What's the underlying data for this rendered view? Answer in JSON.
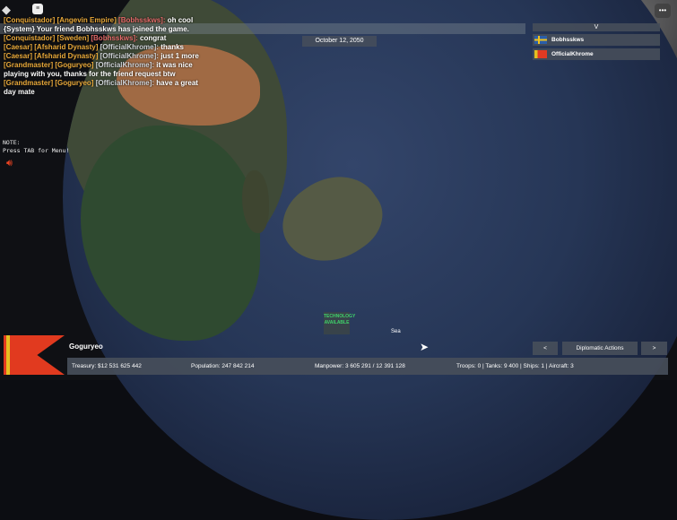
{
  "chat": [
    {
      "rank": "[Conquistador]",
      "nation": "[Angevin Empire]",
      "player": "[Bobhsskws]:",
      "msg": "oh cool"
    },
    {
      "system": "{System} Your friend Bobhsskws has joined the game."
    },
    {
      "rank": "[Conquistador]",
      "nation": "[Sweden]",
      "player": "[Bobhsskws]:",
      "msg": "congrat"
    },
    {
      "rank": "[Caesar]",
      "nation": "[Afsharid Dynasty]",
      "player": "[OfficialKhrome]:",
      "msg": "thanks"
    },
    {
      "rank": "[Caesar]",
      "nation": "[Afsharid Dynasty]",
      "player": "[OfficialKhrome]:",
      "msg": "just 1 more"
    },
    {
      "rank": "[Grandmaster]",
      "nation": "[Goguryeo]",
      "player": "[OfficialKhrome]:",
      "msg": "it was nice playing with you, thanks for the friend request btw"
    },
    {
      "rank": "[Grandmaster]",
      "nation": "[Goguryeo]",
      "player": "[OfficialKhrome]:",
      "msg": "have a great day mate"
    }
  ],
  "date": "October 12, 2050",
  "note": {
    "line1": "NOTE:",
    "line2": "Press TAB for Menu!"
  },
  "players": {
    "toggle": "V",
    "list": [
      {
        "name": "Bobhsskws"
      },
      {
        "name": "OfficialKhrome"
      }
    ]
  },
  "map": {
    "tech": "TECHNOLOGY AVAILABLE",
    "sea": "Sea"
  },
  "country": {
    "name": "Goguryeo"
  },
  "stats": {
    "treasury": "Treasury:  $12 531 625 442",
    "population": "Population: 247 842 214",
    "manpower": "Manpower:  3 605 291  /  12 391 128",
    "military": "Troops: 0  |  Tanks: 9 400  |  Ships: 1  |  Aircraft: 3"
  },
  "buttons": {
    "prev": "<",
    "diplomatic": "Diplomatic Actions",
    "next": ">"
  }
}
